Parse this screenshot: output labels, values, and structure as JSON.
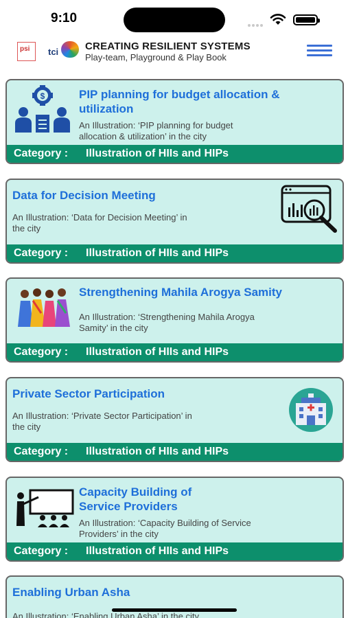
{
  "status_bar": {
    "time": "9:10",
    "icons": [
      "signal-icon",
      "wifi-icon",
      "battery-icon"
    ]
  },
  "header": {
    "logo_psi_text": "psi",
    "logo_tci_text": "tci",
    "title": "CREATING RESILIENT SYSTEMS",
    "subtitle": "Play-team, Playground & Play Book",
    "menu_icon": "hamburger-menu-icon"
  },
  "cards": [
    {
      "title_line1": "PIP planning for budget allocation &",
      "title_line2": "utilization",
      "desc_line1": "An Illustration:  ‘PIP planning for budget",
      "desc_line2": "allocation & utilization’ in the city",
      "category_label": "Category :",
      "category_value": "Illustration of HIIs and HIPs",
      "icon": "budget-team-icon"
    },
    {
      "title_line1": "Data for Decision Meeting",
      "desc_line1": "An Illustration:  ‘Data for Decision Meeting’ in",
      "desc_line2": "the city",
      "category_label": "Category :",
      "category_value": "Illustration of HIIs and HIPs",
      "icon": "data-analysis-icon"
    },
    {
      "title_line1": "Strengthening Mahila Arogya Samity",
      "desc_line1": "An Illustration:  ‘Strengthening Mahila Arogya",
      "desc_line2": "Samity’ in the city",
      "category_label": "Category :",
      "category_value": "Illustration of HIIs and HIPs",
      "icon": "women-group-icon"
    },
    {
      "title_line1": "Private Sector Participation",
      "desc_line1": "An Illustration:  ‘Private Sector Participation’ in",
      "desc_line2": "the city",
      "category_label": "Category :",
      "category_value": "Illustration of HIIs and HIPs",
      "icon": "hospital-building-icon"
    },
    {
      "title_line1": "Capacity Building of",
      "title_line2": "Service Providers",
      "desc_line1": "An Illustration:  ‘Capacity Building of Service",
      "desc_line2": "Providers’ in the city",
      "category_label": "Category :",
      "category_value": "Illustration of HIIs and HIPs",
      "icon": "training-presentation-icon"
    },
    {
      "title_line1": "Enabling Urban Asha",
      "desc_line1": "An Illustration:  ‘Enabling Urban Asha’ in the city"
    }
  ],
  "colors": {
    "card_bg": "#cdf1ec",
    "footer_bg": "#0d8f6c",
    "title_blue": "#1e6fd9",
    "menu_blue": "#3b6fd6"
  }
}
